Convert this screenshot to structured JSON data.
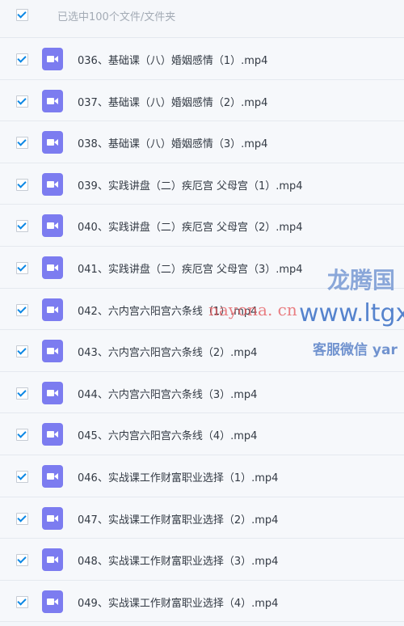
{
  "header": {
    "select_all_checked": true,
    "label": "已选中100个文件/文件夹"
  },
  "files": [
    {
      "name": "036、基础课（八）婚姻感情（1）.mp4",
      "checked": true,
      "icon": "video-file-icon"
    },
    {
      "name": "037、基础课（八）婚姻感情（2）.mp4",
      "checked": true,
      "icon": "video-file-icon"
    },
    {
      "name": "038、基础课（八）婚姻感情（3）.mp4",
      "checked": true,
      "icon": "video-file-icon"
    },
    {
      "name": "039、实践讲盘（二）疾厄宫 父母宫（1）.mp4",
      "checked": true,
      "icon": "video-file-icon"
    },
    {
      "name": "040、实践讲盘（二）疾厄宫 父母宫（2）.mp4",
      "checked": true,
      "icon": "video-file-icon"
    },
    {
      "name": "041、实践讲盘（二）疾厄宫 父母宫（3）.mp4",
      "checked": true,
      "icon": "video-file-icon"
    },
    {
      "name": "042、六内宫六阳宫六条线（1）.mp4",
      "checked": true,
      "icon": "video-file-icon"
    },
    {
      "name": "043、六内宫六阳宫六条线（2）.mp4",
      "checked": true,
      "icon": "video-file-icon"
    },
    {
      "name": "044、六内宫六阳宫六条线（3）.mp4",
      "checked": true,
      "icon": "video-file-icon"
    },
    {
      "name": "045、六内宫六阳宫六条线（4）.mp4",
      "checked": true,
      "icon": "video-file-icon"
    },
    {
      "name": "046、实战课工作财富职业选择（1）.mp4",
      "checked": true,
      "icon": "video-file-icon"
    },
    {
      "name": "047、实战课工作财富职业选择（2）.mp4",
      "checked": true,
      "icon": "video-file-icon"
    },
    {
      "name": "048、实战课工作财富职业选择（3）.mp4",
      "checked": true,
      "icon": "video-file-icon"
    },
    {
      "name": "049、实战课工作财富职业选择（4）.mp4",
      "checked": true,
      "icon": "video-file-icon"
    }
  ],
  "watermark": {
    "title": "龙腾国",
    "url": "www.ltgx",
    "contact": "客服微信 yar",
    "site": "nayona. cn"
  },
  "colors": {
    "checkbox_check": "#0b87e4",
    "video_icon": "#7c7cf0",
    "file_text": "#333a44",
    "header_text": "#a3abb5"
  }
}
